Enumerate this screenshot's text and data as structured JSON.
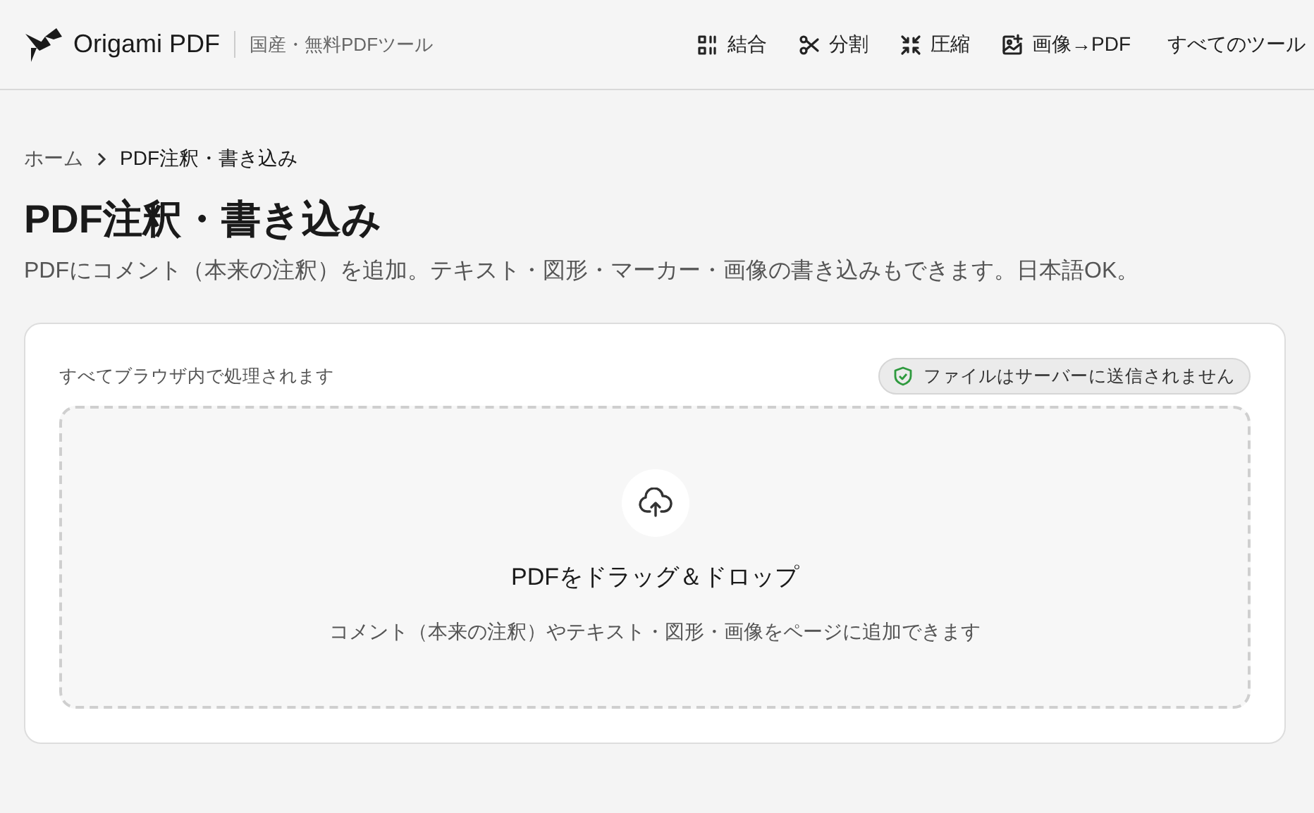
{
  "header": {
    "brand": "Origami PDF",
    "tagline": "国産・無料PDFツール",
    "nav": [
      {
        "label": "結合"
      },
      {
        "label": "分割"
      },
      {
        "label": "圧縮"
      },
      {
        "label": "画像→PDF"
      },
      {
        "label": "すべてのツール"
      }
    ]
  },
  "breadcrumb": [
    {
      "label": "ホーム"
    },
    {
      "label": "PDF注釈・書き込み"
    }
  ],
  "title": "PDF注釈・書き込み",
  "description": "PDFにコメント（本来の注釈）を追加。テキスト・図形・マーカー・画像の書き込みもできます。日本語OK。",
  "card": {
    "note": "すべてブラウザ内で処理されます",
    "privacy_badge": "ファイルはサーバーに送信されません",
    "dropzone": {
      "title": "PDFをドラッグ＆ドロップ",
      "hint": "コメント（本来の注釈）やテキスト・図形・画像をページに追加できます"
    }
  }
}
